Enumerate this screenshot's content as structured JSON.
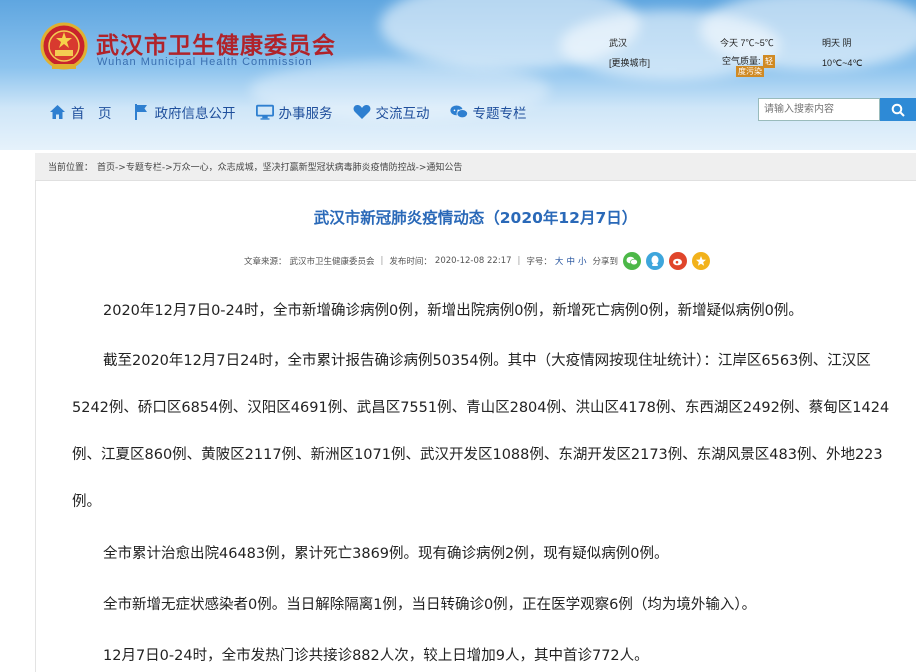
{
  "site": {
    "title": "武汉市卫生健康委员会",
    "subtitle": "Wuhan Municipal Health Commission"
  },
  "weather": {
    "city": "武汉",
    "change_city": "[更换城市]",
    "today": "今天 7℃~5℃",
    "air_quality_label": "空气质量:",
    "air_quality_value": "轻",
    "air_quality_value2": "度污染",
    "tomorrow": "明天 阴",
    "tomorrow_temp": "10℃~4℃"
  },
  "nav": {
    "items": [
      {
        "label": "首　页",
        "icon": "home-icon"
      },
      {
        "label": "政府信息公开",
        "icon": "flag-icon"
      },
      {
        "label": "办事服务",
        "icon": "monitor-icon"
      },
      {
        "label": "交流互动",
        "icon": "heart-icon"
      },
      {
        "label": "专题专栏",
        "icon": "chat-icon"
      }
    ]
  },
  "search": {
    "placeholder": "请输入搜索内容"
  },
  "breadcrumb": {
    "prefix": "当前位置：",
    "items": [
      "首页",
      "->专题专栏",
      "->万众一心，众志成城，坚决打赢新型冠状病毒肺炎疫情防控战",
      "->通知公告"
    ]
  },
  "article": {
    "title": "武汉市新冠肺炎疫情动态（2020年12月7日）",
    "meta": {
      "source_label": "文章来源：",
      "source": "武汉市卫生健康委员会",
      "sep": "|",
      "published_label": "发布时间：",
      "published": "2020-12-08 22:17",
      "font_label": "字号：",
      "font_sizes": [
        "大",
        "中",
        "小"
      ],
      "share_label": "分享到"
    },
    "share_icons": [
      {
        "name": "wechat-icon",
        "color": "#4cb848"
      },
      {
        "name": "qq-icon",
        "color": "#3ea6dc"
      },
      {
        "name": "weibo-icon",
        "color": "#e0452b"
      },
      {
        "name": "qzone-icon",
        "color": "#f2b21b"
      }
    ],
    "paragraphs": [
      "2020年12月7日0-24时，全市新增确诊病例0例，新增出院病例0例，新增死亡病例0例，新增疑似病例0例。",
      "截至2020年12月7日24时，全市累计报告确诊病例50354例。其中（大疫情网按现住址统计）：江岸区6563例、江汉区5242例、硚口区6854例、汉阳区4691例、武昌区7551例、青山区2804例、洪山区4178例、东西湖区2492例、蔡甸区1424例、江夏区860例、黄陂区2117例、新洲区1071例、武汉开发区1088例、东湖开发区2173例、东湖风景区483例、外地223例。",
      "全市累计治愈出院46483例，累计死亡3869例。现有确诊病例2例，现有疑似病例0例。",
      "全市新增无症状感染者0例。当日解除隔离1例，当日转确诊0例，正在医学观察6例（均为境外输入）。",
      "12月7日0-24时，全市发热门诊共接诊882人次，较上日增加9人，其中首诊772人。"
    ]
  }
}
